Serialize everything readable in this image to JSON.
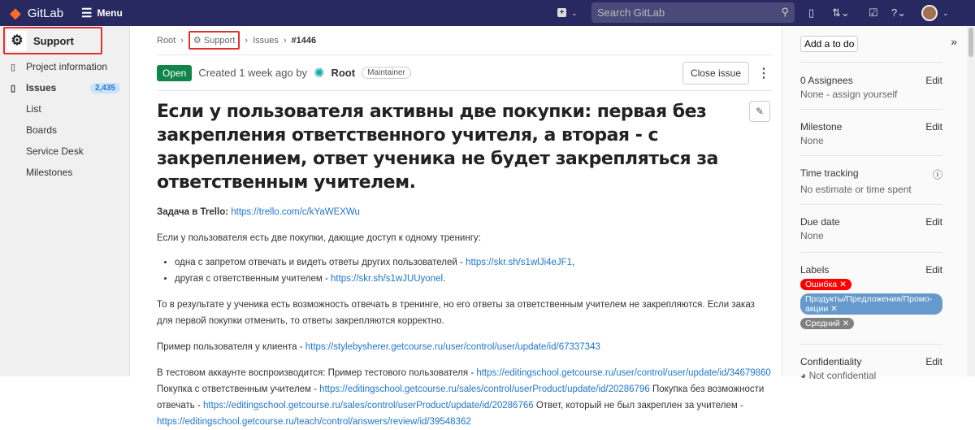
{
  "header": {
    "brand": "GitLab",
    "menu": "Menu",
    "search_placeholder": "Search GitLab"
  },
  "sidebar": {
    "project": "Support",
    "items": [
      {
        "label": "Project information"
      },
      {
        "label": "Issues",
        "count": "2,435"
      },
      {
        "label": "List"
      },
      {
        "label": "Boards"
      },
      {
        "label": "Service Desk"
      },
      {
        "label": "Milestones"
      }
    ]
  },
  "breadcrumb": [
    "Root",
    "Support",
    "Issues",
    "#1446"
  ],
  "issue": {
    "status": "Open",
    "created": "Created 1 week ago by",
    "author": "Root",
    "role": "Maintainer",
    "close_button": "Close issue",
    "title": "Если у пользователя активны две покупки: первая без закрепления ответственного учителя, а вторая - с закреплением, ответ ученика не будет закрепляться за ответственным учителем.",
    "task_label": "Задача в Trello:",
    "task_link": "https://trello.com/c/kYaWEXWu",
    "p1": "Если у пользователя есть две покупки, дающие доступ к одному тренингу:",
    "li1": "одна с запретом отвечать и видеть ответы других пользователей - ",
    "li1_link": "https://skr.sh/s1wlJi4eJF1",
    "li2": "другая с ответственным учителем - ",
    "li2_link": "https://skr.sh/s1wJUUyonel",
    "p2": "То в результате у ученика есть возможность отвечать в тренинге, но его ответы за ответственным учителем не закрепляются. Если заказ для первой покупки отменить, то ответы закрепляются корректно.",
    "p3": "Пример пользователя у клиента - ",
    "p3_link": "https://stylebysherer.getcourse.ru/user/control/user/update/id/67337343",
    "p4a": "В тестовом аккаунте воспроизводится: Пример тестового пользователя - ",
    "p4_link1": "https://editingschool.getcourse.ru/user/control/user/update/id/34679860",
    "p4b": " Покупка с ответственным учителем - ",
    "p4_link2": "https://editingschool.getcourse.ru/sales/control/userProduct/update/id/20286796",
    "p4c": " Покупка без возможности отвечать - ",
    "p4_link3": "https://editingschool.getcourse.ru/sales/control/userProduct/update/id/20286766",
    "p4d": " Ответ, который не был закреплен за учителем - ",
    "p4_link4": "https://editingschool.getcourse.ru/teach/control/answers/review/id/39548362"
  },
  "right": {
    "todo": "Add a to do",
    "edit": "Edit",
    "assignees": "0 Assignees",
    "assignees_value": "None - assign yourself",
    "milestone": "Milestone",
    "milestone_value": "None",
    "time": "Time tracking",
    "time_value": "No estimate or time spent",
    "due": "Due date",
    "due_value": "None",
    "labels": "Labels",
    "label_list": [
      {
        "text": "Ошибка",
        "color": "#ff0000"
      },
      {
        "text": "Продукты/Предложения/Промо-акции",
        "color": "#6699cc"
      },
      {
        "text": "Средний",
        "color": "#808080"
      }
    ],
    "conf": "Confidentiality",
    "conf_value": "Not confidential"
  }
}
